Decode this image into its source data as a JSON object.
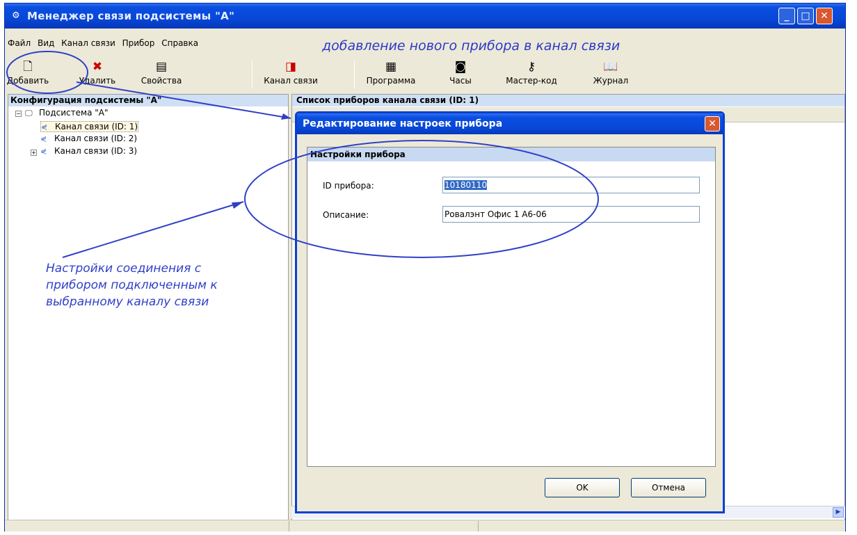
{
  "window": {
    "title": "Менеджер связи подсистемы \"А\"",
    "controls": {
      "minimize": "_",
      "maximize": "□",
      "close": "✕"
    }
  },
  "menu": [
    "Файл",
    "Вид",
    "Канал связи",
    "Прибор",
    "Справка"
  ],
  "annotation_top": "добавление нового прибора в канал связи",
  "toolbar": {
    "add": "Добавить",
    "delete": "Удалить",
    "properties": "Свойства",
    "channel": "Канал связи",
    "program": "Программа",
    "clock": "Часы",
    "mastercode": "Мастер-код",
    "journal": "Журнал"
  },
  "left_panel": {
    "header": "Конфигурация подсистемы \"А\"",
    "root": "Подсистема \"А\"",
    "items": [
      "Канал связи (ID: 1)",
      "Канал связи (ID: 2)",
      "Канал связи (ID: 3)"
    ]
  },
  "right_panel": {
    "header": "Список приборов канала связи (ID: 1)"
  },
  "dialog": {
    "title": "Редактирование настроек прибора",
    "group_header": "Настройки прибора",
    "id_label": "ID прибора:",
    "id_value": "10180110",
    "desc_label": "Описание:",
    "desc_value": "Ровалэнт Офис 1 А6-06",
    "ok": "OK",
    "cancel": "Отмена"
  },
  "annotation_left": "Настройки соединения с прибором подключенным к выбранному каналу связи",
  "colors": {
    "titlebar": "#0848d8",
    "annotation": "#3140c8",
    "panel_header": "#cfe0f5"
  }
}
